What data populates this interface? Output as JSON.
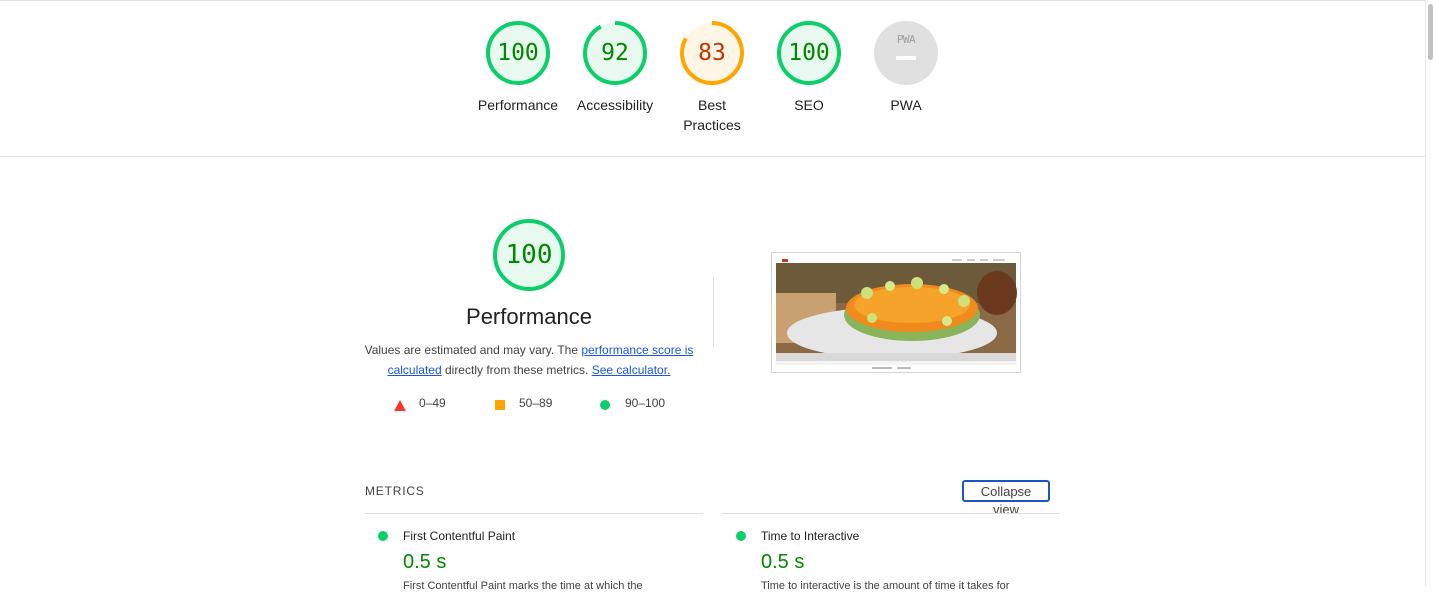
{
  "scores": [
    {
      "label": "Performance",
      "value": "100",
      "color": "#0cce6b",
      "fill": "#e8f9ef",
      "text_color": "#008800",
      "fraction": 1.0
    },
    {
      "label": "Accessibility",
      "value": "92",
      "color": "#0cce6b",
      "fill": "#e8f9ef",
      "text_color": "#008800",
      "fraction": 0.92
    },
    {
      "label": "Best Practices",
      "value": "83",
      "color": "#ffa400",
      "fill": "#fff6e5",
      "text_color": "#c33300",
      "fraction": 0.83
    },
    {
      "label": "SEO",
      "value": "100",
      "color": "#0cce6b",
      "fill": "#e8f9ef",
      "text_color": "#008800",
      "fraction": 1.0
    },
    {
      "label": "PWA",
      "value": "PWA",
      "color": "#e0e0e0",
      "fill": "#e0e0e0",
      "text_color": "#9e9e9e"
    }
  ],
  "performance": {
    "score": "100",
    "title": "Performance",
    "desc_prefix": "Values are estimated and may vary. The ",
    "desc_link1": "performance score is calculated",
    "desc_middle": " directly from these metrics. ",
    "desc_link2": "See calculator.",
    "legend": [
      {
        "icon": "triangle-red-icon",
        "range": "0–49",
        "color": "#ff3333"
      },
      {
        "icon": "square-orange-icon",
        "range": "50–89",
        "color": "#ffa400"
      },
      {
        "icon": "circle-green-icon",
        "range": "90–100",
        "color": "#0cce6b"
      }
    ]
  },
  "metrics": {
    "header": "METRICS",
    "collapse_label": "Collapse view",
    "items": [
      {
        "name": "First Contentful Paint",
        "value": "0.5 s",
        "desc": "First Contentful Paint marks the time at which the"
      },
      {
        "name": "Time to Interactive",
        "value": "0.5 s",
        "desc": "Time to interactive is the amount of time it takes for"
      }
    ]
  }
}
